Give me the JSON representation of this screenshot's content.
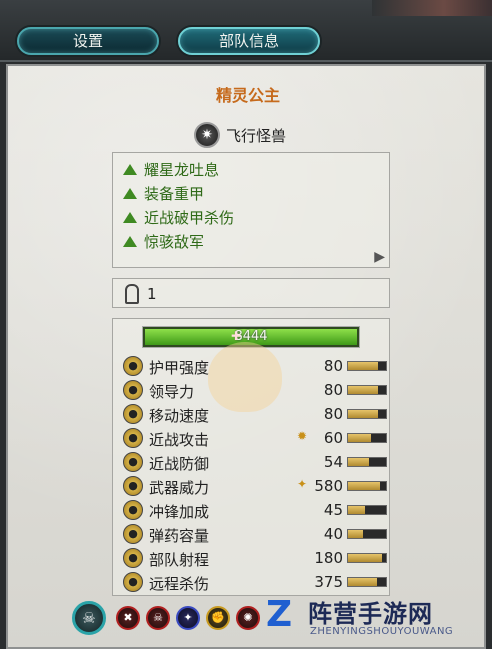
{
  "tabs": {
    "settings": "设置",
    "unit_info": "部队信息"
  },
  "unit": {
    "name": "精灵公主",
    "type_label": "飞行怪兽",
    "type_icon": "star-icon"
  },
  "abilities": [
    {
      "label": "耀星龙吐息"
    },
    {
      "label": "装备重甲"
    },
    {
      "label": "近战破甲杀伤"
    },
    {
      "label": "惊骇敌军"
    }
  ],
  "more_indicator": "▶",
  "unit_count": "1",
  "health": {
    "value": "8444",
    "fraction": 1.0
  },
  "stats": [
    {
      "label": "护甲强度",
      "value": "80",
      "bar": 0.8,
      "mark": "",
      "icon": "armor-icon"
    },
    {
      "label": "领导力",
      "value": "80",
      "bar": 0.8,
      "mark": "",
      "icon": "leadership-icon"
    },
    {
      "label": "移动速度",
      "value": "80",
      "bar": 0.8,
      "mark": "",
      "icon": "speed-icon"
    },
    {
      "label": "近战攻击",
      "value": "60",
      "bar": 0.6,
      "mark": "✹",
      "icon": "melee-attack-icon"
    },
    {
      "label": "近战防御",
      "value": "54",
      "bar": 0.54,
      "mark": "",
      "icon": "melee-defense-icon"
    },
    {
      "label": "武器威力",
      "value": "580",
      "bar": 0.85,
      "mark": "✦",
      "icon": "weapon-strength-icon"
    },
    {
      "label": "冲锋加成",
      "value": "45",
      "bar": 0.45,
      "mark": "",
      "icon": "charge-bonus-icon"
    },
    {
      "label": "弹药容量",
      "value": "40",
      "bar": 0.4,
      "mark": "",
      "icon": "ammo-icon"
    },
    {
      "label": "部队射程",
      "value": "180",
      "bar": 0.9,
      "mark": "",
      "icon": "range-icon"
    },
    {
      "label": "远程杀伤",
      "value": "375",
      "bar": 0.75,
      "mark": "",
      "icon": "missile-damage-icon"
    }
  ],
  "watermark": {
    "title": "阵营手游网",
    "subtitle": "ZHENYINGSHOUYOUWANG"
  },
  "colors": {
    "accent_tab": "#6fd0d4",
    "name": "#c66a1c",
    "ability_green": "#2f6a18",
    "hp_green": "#5fbf2a"
  }
}
